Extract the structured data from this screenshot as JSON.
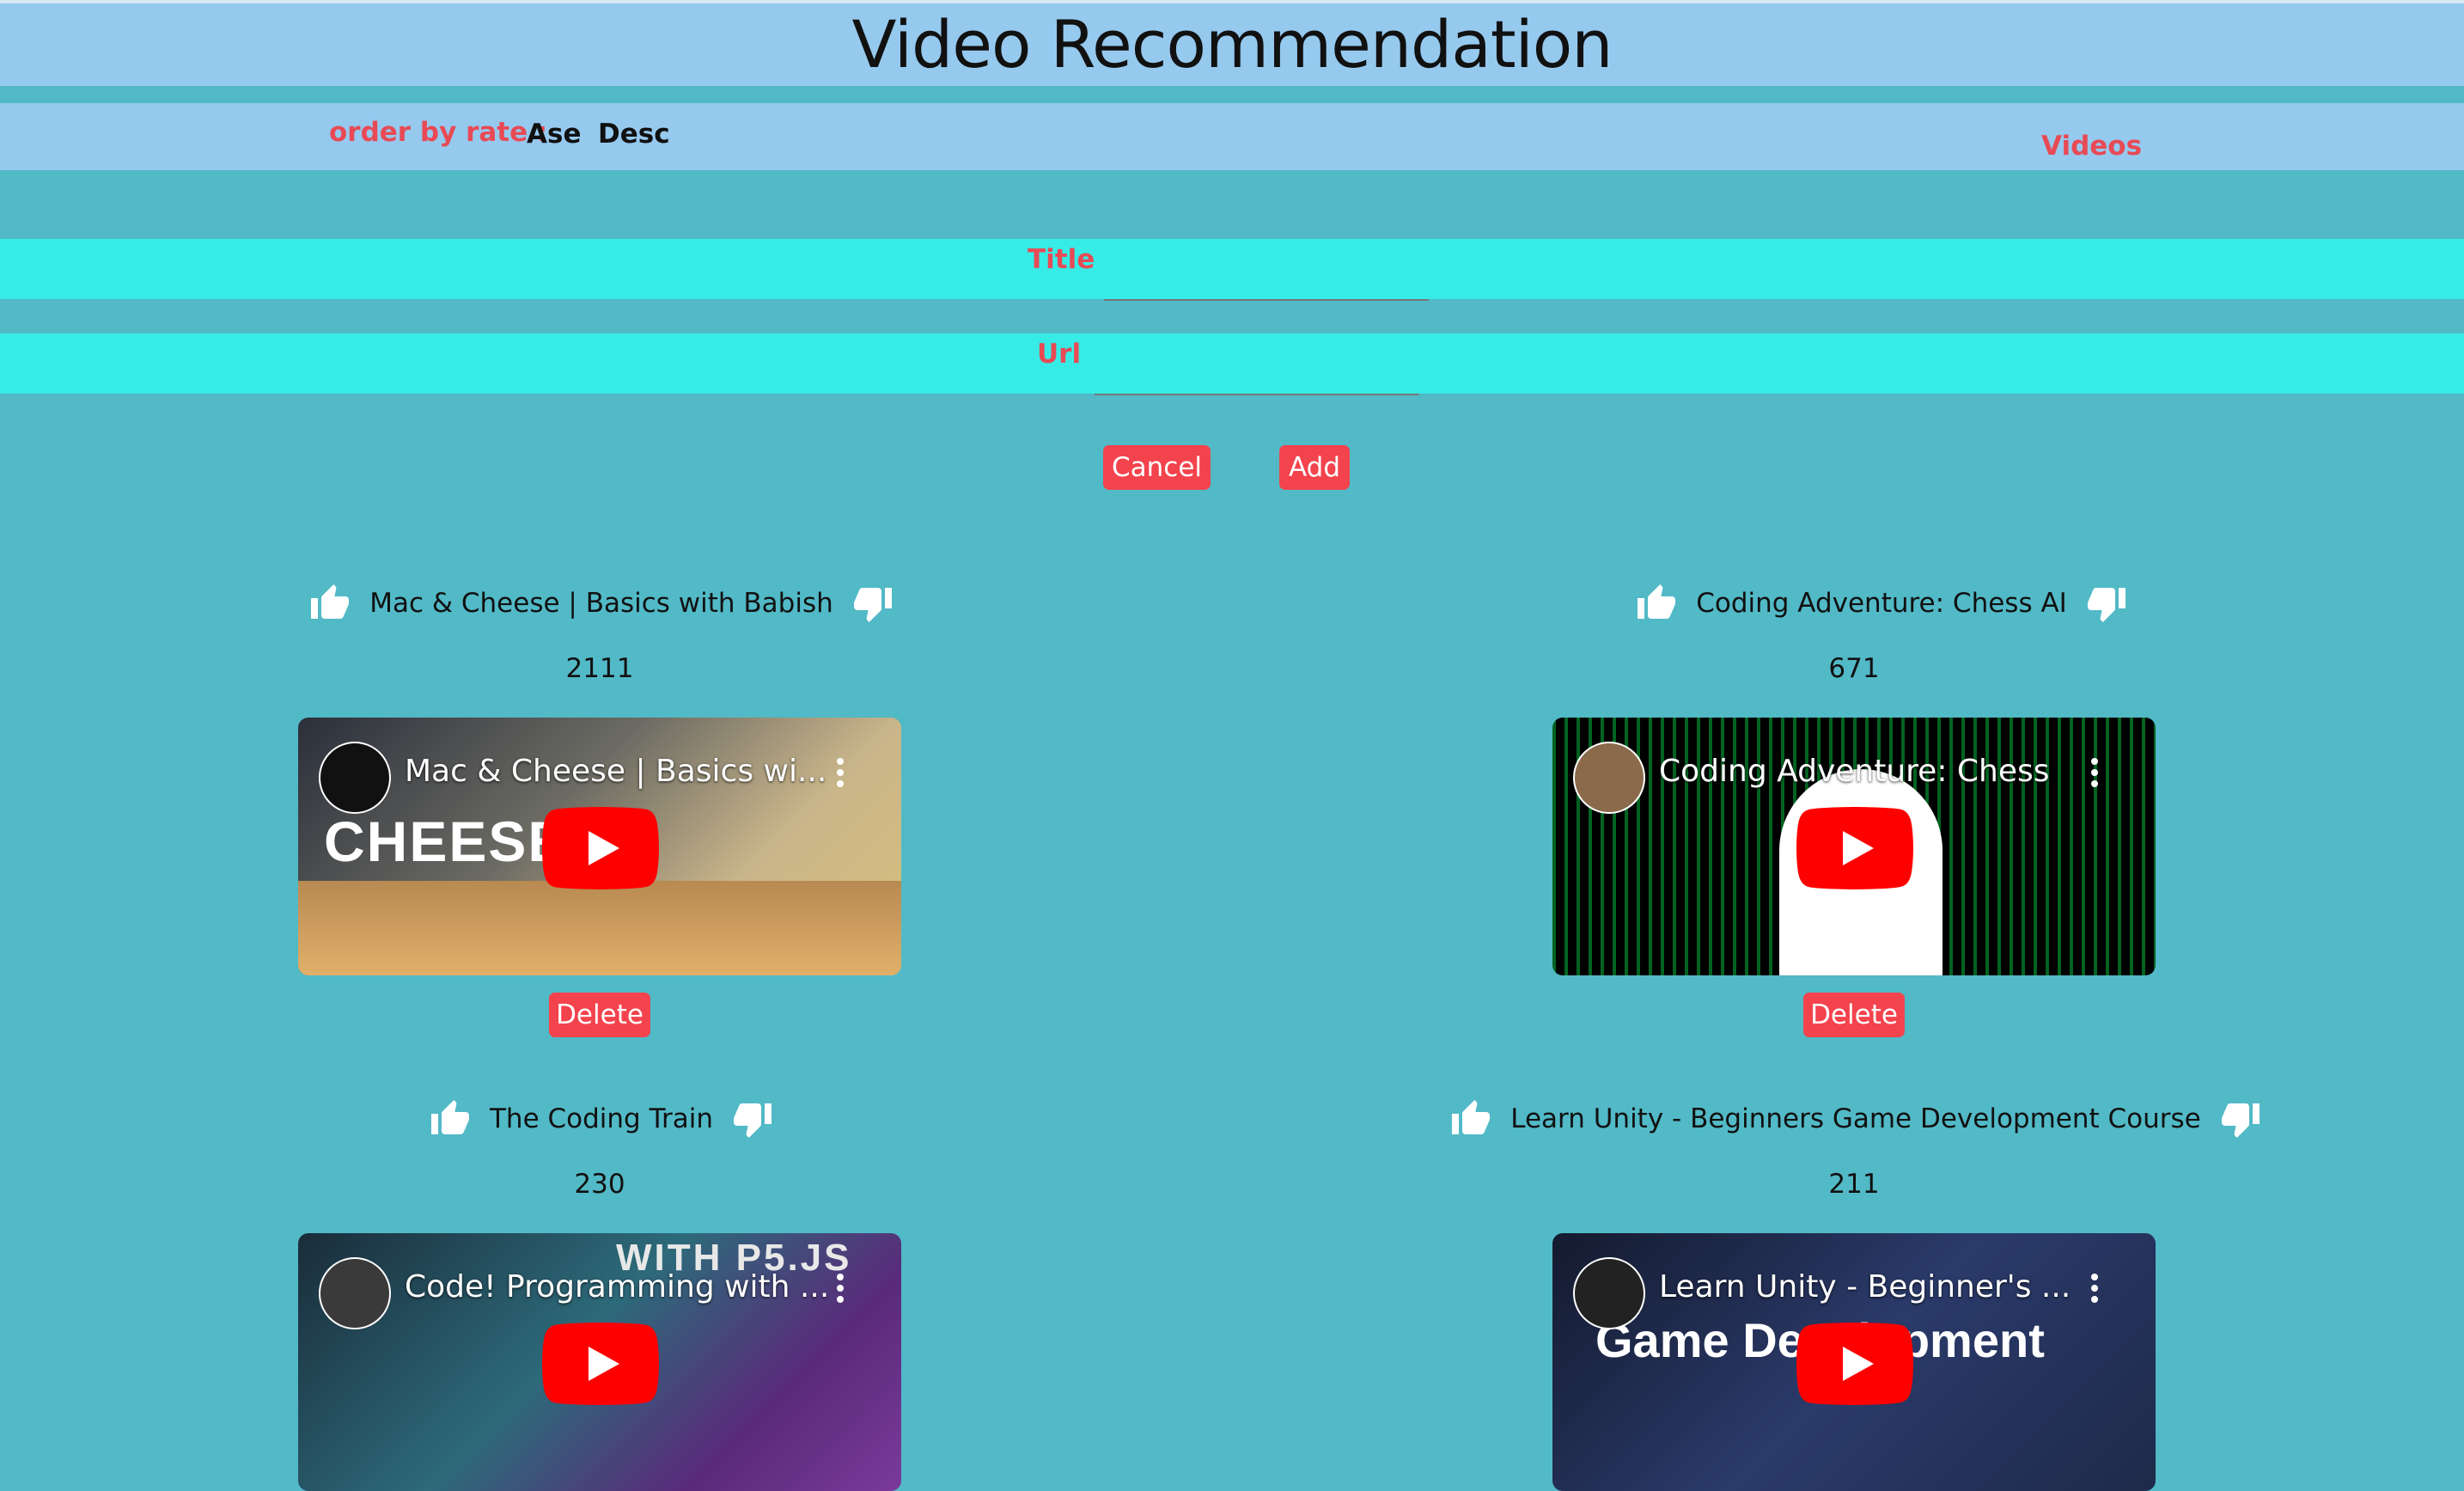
{
  "header": {
    "title": "Video Recommendation"
  },
  "order": {
    "label": "order by rate :",
    "asc_label": "Ase",
    "desc_label": "Desc"
  },
  "nav": {
    "videos_label": "Videos"
  },
  "form": {
    "title_label": "Title",
    "url_label": "Url",
    "title_value": "",
    "url_value": "",
    "cancel_label": "Cancel",
    "add_label": "Add"
  },
  "videos": [
    {
      "title": "Mac & Cheese | Basics with Babish",
      "rating": "2111",
      "player_title": "Mac & Cheese | Basics wi...",
      "thumb_text": "CHEESE",
      "delete_label": "Delete"
    },
    {
      "title": "Coding Adventure: Chess AI",
      "rating": "671",
      "player_title": "Coding Adventure: Chess",
      "delete_label": "Delete"
    },
    {
      "title": "The Coding Train",
      "rating": "230",
      "player_title": "Code! Programming with ...",
      "thumb_text": "WITH P5.JS"
    },
    {
      "title": "Learn Unity - Beginners Game Development Course",
      "rating": "211",
      "player_title": "Learn Unity - Beginner's ...",
      "thumb_text": "Game Development"
    }
  ],
  "icons": {
    "like": "thumbs-up-icon",
    "dislike": "thumbs-down-icon",
    "play": "youtube-play-icon",
    "menu": "kebab-menu-icon"
  },
  "colors": {
    "accent_red": "#f3434d",
    "label_red": "#e84a55",
    "bg_teal": "#52b9c7",
    "bar_blue": "#96c9ee",
    "field_cyan": "#37ece6"
  }
}
